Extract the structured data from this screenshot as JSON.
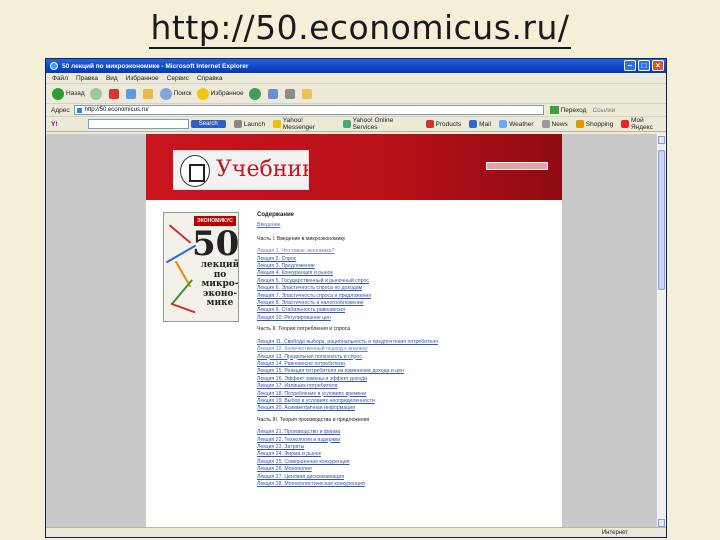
{
  "slide": {
    "title": "http://50.economicus.ru/"
  },
  "browser": {
    "window_title": "50 лекций по микроэкономике - Microsoft Internet Explorer",
    "menu": [
      "Файл",
      "Правка",
      "Вид",
      "Избранное",
      "Сервис",
      "Справка"
    ],
    "toolbar": {
      "back": "Назад",
      "search": "Поиск",
      "favorites": "Избранное"
    },
    "address": {
      "label": "Адрес",
      "value": "http://50.economicus.ru/",
      "go": "Переход",
      "links": "Ссылки"
    },
    "yahoo": {
      "logo": "Y!",
      "search_btn": "Search",
      "items": [
        "Launch",
        "Yahoo! Messenger",
        "Yahoo! Online Services",
        "Products",
        "Mail",
        "Weather",
        "News",
        "Shopping",
        "Мой Яндекс"
      ]
    },
    "status": {
      "zone": "Интернет"
    }
  },
  "page": {
    "logo_text": "Учебники",
    "cover": {
      "header": "ЭКОНОМИКУС",
      "number": "50",
      "words": [
        "лекций",
        "по",
        "микро-",
        "эконо-",
        "мике"
      ]
    },
    "toc": {
      "heading": "Содержание",
      "sub": "Введение",
      "parts": [
        {
          "title": "Часть I. Введение в микроэкономику",
          "chapters": [
            "Лекция 1. Что такое экономика?",
            "Лекция 2. Спрос",
            "Лекция 3. Предложение",
            "Лекция 4. Конкуренция и рынок",
            "Лекция 5. Государственный и рыночный спрос",
            "Лекция 6. Эластичность спроса по доходам",
            "Лекция 7. Эластичность спроса и предложения",
            "Лекция 8. Эластичность и налогообложение",
            "Лекция 9. Стабильность равновесия",
            "Лекция 10. Регулирование цен"
          ]
        },
        {
          "title": "Часть II. Теория потребления и спроса",
          "chapters": [
            "Лекция 11. Свобода выбора, рациональность и предпочтения потребителя",
            "Лекция 12. Количественный подход к анализу",
            "Лекция 13. Предельная полезность и спрос",
            "Лекция 14. Равновесие потребителя",
            "Лекция 15. Реакция потребителя на изменение дохода и цен",
            "Лекция 16. Эффект замены и эффект дохода",
            "Лекция 17. Излишек потребителя",
            "Лекция 18. Потребление в условиях времени",
            "Лекция 19. Выбор в условиях неопределенности",
            "Лекция 20. Асимметричная информация"
          ]
        },
        {
          "title": "Часть III. Теория производства и предложения",
          "chapters": [
            "Лекция 21. Производство и фирма",
            "Лекция 22. Технология и издержки",
            "Лекция 23. Затраты",
            "Лекция 24. Фирма и рынок",
            "Лекция 25. Совершенная конкуренция",
            "Лекция 26. Монополия",
            "Лекция 27. Ценовая дискриминация",
            "Лекция 28. Монополистическая конкуренция"
          ]
        }
      ]
    }
  },
  "colors": {
    "banner": "#c9141f",
    "link": "#3355aa"
  }
}
